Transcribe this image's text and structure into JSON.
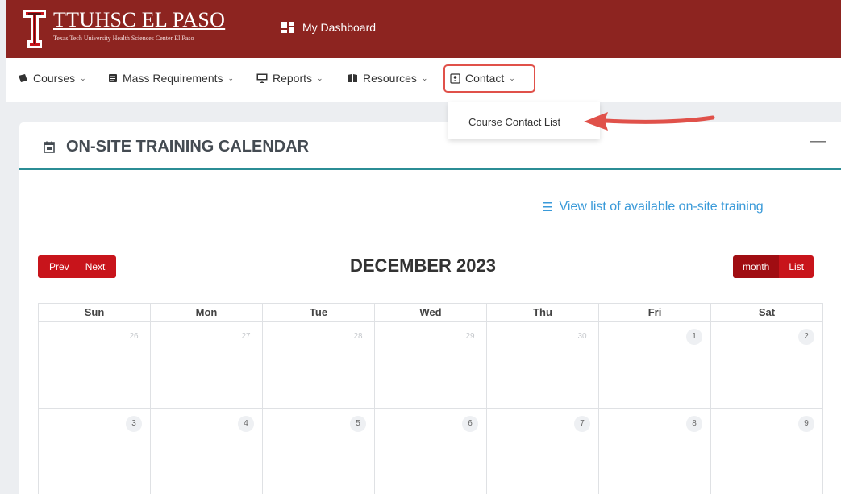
{
  "header": {
    "brand_title": "TTUHSC EL PASO",
    "brand_subtitle": "Texas Tech University Health Sciences Center El Paso",
    "dashboard_label": "My Dashboard"
  },
  "nav": {
    "items": [
      {
        "label": "Courses",
        "icon": "courses-icon"
      },
      {
        "label": "Mass Requirements",
        "icon": "requirements-icon"
      },
      {
        "label": "Reports",
        "icon": "reports-icon"
      },
      {
        "label": "Resources",
        "icon": "resources-icon"
      },
      {
        "label": "Contact",
        "icon": "contact-icon"
      }
    ],
    "dropdown": {
      "items": [
        "Course Contact List"
      ]
    }
  },
  "card": {
    "title": "ON-SITE TRAINING CALENDAR",
    "minimize_label": "—",
    "view_list_label": "View list of available on-site training"
  },
  "calendar": {
    "prev_label": "Prev",
    "next_label": "Next",
    "title": "DECEMBER 2023",
    "month_label": "month",
    "list_label": "List",
    "weekdays": [
      "Sun",
      "Mon",
      "Tue",
      "Wed",
      "Thu",
      "Fri",
      "Sat"
    ],
    "weeks": [
      [
        "26",
        "27",
        "28",
        "29",
        "30",
        "1",
        "2"
      ],
      [
        "3",
        "4",
        "5",
        "6",
        "7",
        "8",
        "9"
      ]
    ]
  },
  "colors": {
    "header_bg": "#8d2420",
    "accent_teal": "#2b8d95",
    "button_red": "#c8141b",
    "link_blue": "#3a9ad9",
    "annotation_red": "#e0514a"
  }
}
